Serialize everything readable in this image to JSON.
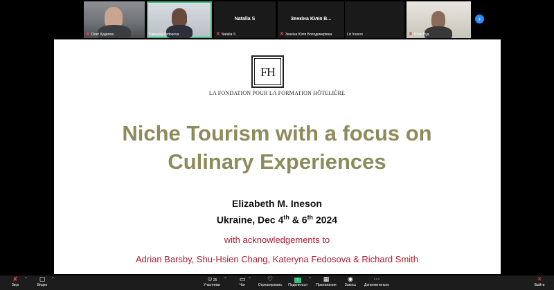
{
  "participants": [
    {
      "name": "Олег Кудилов",
      "muted": true,
      "video": true
    },
    {
      "name": "Kateryna Fedosova",
      "muted": false,
      "video": true,
      "active": true
    },
    {
      "name": "Natalia S",
      "display_name": "Natalia S",
      "muted": true,
      "video": false
    },
    {
      "name": "Зенкіна Юлія Володимирівна",
      "display_name": "Зенкіна Юлія В...",
      "muted": true,
      "video": false
    },
    {
      "name": "Liz Ineson",
      "muted": false,
      "video": false
    },
    {
      "name": "Юлія Руд",
      "muted": true,
      "video": true
    }
  ],
  "slide": {
    "logo_text": "FH",
    "foundation": "LA FONDATION POUR LA FORMATION HÔTELIÈRE",
    "title_line1": "Niche Tourism with a focus on",
    "title_line2": "Culinary Experiences",
    "author": "Elizabeth M. Ineson",
    "place_prefix": "Ukraine, Dec 4",
    "sup1": "th",
    "place_mid": " & 6",
    "sup2": "th",
    "place_year": " 2024",
    "acknowledgement": "with acknowledgements to",
    "names": "Adrian Barsby, Shu-Hsien Chang, Kateryna Fedosova & Richard Smith"
  },
  "toolbar": {
    "audio": "Звук",
    "video": "Видео",
    "participants": "Участники",
    "participants_count": "25",
    "chat": "Чат",
    "react": "Отреагировать",
    "share": "Поделиться",
    "apps": "Приложения",
    "record": "Запись",
    "more": "Дополнительно",
    "leave": "Выйти"
  },
  "colors": {
    "title": "#8d8a5b",
    "red_text": "#b01c2e",
    "active_speaker": "#2ec27e",
    "share_green": "#2ec27e",
    "leave_red": "#e5473f"
  }
}
